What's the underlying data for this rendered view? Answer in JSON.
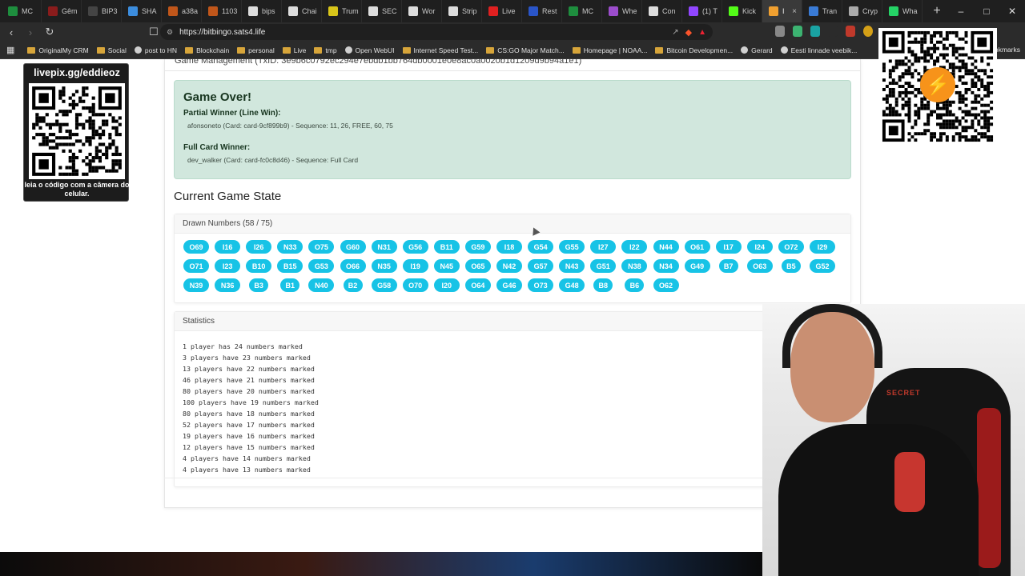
{
  "browser": {
    "tabs": [
      {
        "label": "MC",
        "color": "#1e8e3e"
      },
      {
        "label": "Gêm",
        "color": "#8a1c1c"
      },
      {
        "label": "BIP3",
        "color": "#444444"
      },
      {
        "label": "SHA",
        "color": "#3c8dde"
      },
      {
        "label": "a38a",
        "color": "#c0561a"
      },
      {
        "label": "1103",
        "color": "#c0561a"
      },
      {
        "label": "bips",
        "color": "#dddddd"
      },
      {
        "label": "Chai",
        "color": "#dddddd"
      },
      {
        "label": "Trum",
        "color": "#d8c51a"
      },
      {
        "label": "SEC",
        "color": "#dddddd"
      },
      {
        "label": "Wor",
        "color": "#dddddd"
      },
      {
        "label": "Strip",
        "color": "#dddddd"
      },
      {
        "label": "Live",
        "color": "#e02020"
      },
      {
        "label": "Rest",
        "color": "#2a55c8"
      },
      {
        "label": "MC",
        "color": "#1e8e3e"
      },
      {
        "label": "Whe",
        "color": "#9c4dcc"
      },
      {
        "label": "Con",
        "color": "#dddddd"
      },
      {
        "label": "(1) T",
        "color": "#9146ff"
      },
      {
        "label": "Kick",
        "color": "#53fc18"
      },
      {
        "label": "I",
        "color": "#f0a030",
        "active": true
      },
      {
        "label": "Tran",
        "color": "#3a7bd5"
      },
      {
        "label": "Cryp",
        "color": "#aaaaaa"
      },
      {
        "label": "Wha",
        "color": "#25d366"
      }
    ],
    "new_tab": "+",
    "url": "https://bitbingo.sats4.life",
    "bookmarks": [
      "OriginalMy CRM",
      "Social",
      "post to HN",
      "Blockchain",
      "personal",
      "Live",
      "tmp",
      "Open WebUI",
      "Internet Speed Test...",
      "CS:GO Major Match...",
      "Homepage | NOAA...",
      "Bitcoin Developmen...",
      "Gerard",
      "Eesti linnade veebik..."
    ],
    "bookmarks_more": "okmarks"
  },
  "page": {
    "header_partial": "Game Management (TxID: 3e9b6c0792ec294e7ebdb1bb764db0001e0e8ac0a0020b1d1209d9b94a1e1)",
    "game_over": {
      "title": "Game Over!",
      "partial_label": "Partial Winner (Line Win):",
      "partial_detail": "afonsoneto (Card: card-9cf899b9) - Sequence: 11, 26, FREE, 60, 75",
      "full_label": "Full Card Winner:",
      "full_detail": "dev_walker (Card: card-fc0c8d46) - Sequence: Full Card"
    },
    "state_title": "Current Game State",
    "drawn_header": "Drawn Numbers (58 / 75)",
    "drawn_numbers": [
      [
        "O69",
        "I16",
        "I26",
        "N33",
        "O75",
        "G60",
        "N31",
        "G56",
        "B11",
        "G59",
        "I18",
        "G54",
        "G55",
        "I27",
        "I22",
        "N44",
        "O61",
        "I17",
        "I24",
        "O72",
        "I29"
      ],
      [
        "O71",
        "I23",
        "B10",
        "B15",
        "G53",
        "O66",
        "N35",
        "I19",
        "N45",
        "O65",
        "N42",
        "G57",
        "N43",
        "G51",
        "N38",
        "N34",
        "G49",
        "B7",
        "O63",
        "B5",
        "G52"
      ],
      [
        "N39",
        "N36",
        "B3",
        "B1",
        "N40",
        "B2",
        "G58",
        "O70",
        "I20",
        "O64",
        "G46",
        "O73",
        "G48",
        "B8",
        "B6",
        "O62"
      ]
    ],
    "ball_color": "#17c3e6",
    "stats_header": "Statistics",
    "stats": [
      "1 player has 24 numbers marked",
      "3 players have 23 numbers marked",
      "13 players have 22 numbers marked",
      "46 players have 21 numbers marked",
      "80 players have 20 numbers marked",
      "100 players have 19 numbers marked",
      "80 players have 18 numbers marked",
      "52 players have 17 numbers marked",
      "19 players have 16 numbers marked",
      "12 players have 15 numbers marked",
      "4 players have 14 numbers marked",
      "4 players have 13 numbers marked"
    ]
  },
  "overlay": {
    "livepix_url": "livepix.gg/eddieoz",
    "livepix_caption": "leia o código com a câmera do celular.",
    "chair_brand": "SECRET"
  }
}
